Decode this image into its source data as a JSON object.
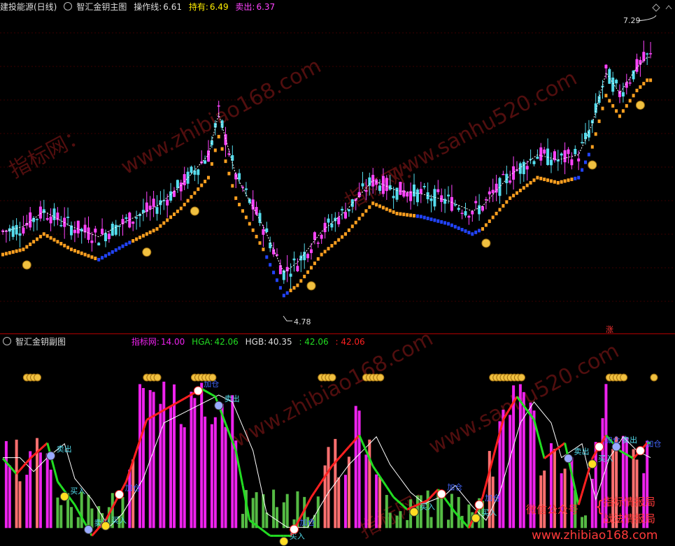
{
  "main_header": {
    "stock": "建投能源(日线)",
    "indicator": "智汇金钥主图",
    "op_label": "操作线:",
    "op_value": "6.61",
    "hold_label": "持有:",
    "hold_value": "6.49",
    "sell_label": "卖出:",
    "sell_value": "6.37"
  },
  "sub_header": {
    "indicator": "智汇金钥副图",
    "zbw_label": "指标网:",
    "zbw_value": "14.00",
    "hga_label": "HGA:",
    "hga_value": "42.06",
    "hgb_label": "HGB:",
    "hgb_value": "40.35",
    "v4": ": 42.06",
    "v5": ": 42.06"
  },
  "labels": {
    "high": "7.29",
    "low": "4.78",
    "zhang": "涨",
    "sell": "卖出",
    "buy": "买入",
    "add": "加仓",
    "wechat": "微信公众号",
    "brand1": "指标情报局",
    "brand2": "战法情报局",
    "site": "www.zhibiao168.com",
    "wm1": "www.zhibiao168.com",
    "wm2": "www.sanhu520.com",
    "wm3": "指标网：",
    "wm4": "指标网："
  },
  "colors": {
    "up": "#ff44ff",
    "down": "#55ddee",
    "hold": "#ffa020",
    "sell_line": "#2244ff",
    "green": "#22dd22",
    "red": "#ff2020",
    "magenta": "#ee22ee",
    "salmon": "#ff7070",
    "gbar": "#55bb44"
  },
  "chart_data": [
    {
      "type": "candlestick",
      "y_range": [
        4.5,
        7.5
      ],
      "high": 7.29,
      "low": 4.78,
      "anchors": [
        [
          0,
          5.35
        ],
        [
          6,
          5.4
        ],
        [
          12,
          5.55
        ],
        [
          20,
          5.4
        ],
        [
          28,
          5.3
        ],
        [
          36,
          5.45
        ],
        [
          45,
          5.6
        ],
        [
          52,
          5.8
        ],
        [
          60,
          6.1
        ],
        [
          63,
          6.5
        ],
        [
          68,
          5.9
        ],
        [
          76,
          5.4
        ],
        [
          82,
          4.95
        ],
        [
          86,
          5.05
        ],
        [
          93,
          5.35
        ],
        [
          100,
          5.55
        ],
        [
          108,
          5.85
        ],
        [
          115,
          5.75
        ],
        [
          122,
          5.72
        ],
        [
          130,
          5.65
        ],
        [
          137,
          5.55
        ],
        [
          140,
          5.6
        ],
        [
          148,
          5.9
        ],
        [
          156,
          6.1
        ],
        [
          162,
          6.05
        ],
        [
          168,
          6.1
        ],
        [
          172,
          6.4
        ],
        [
          176,
          6.9
        ],
        [
          180,
          6.7
        ],
        [
          185,
          6.95
        ],
        [
          188,
          7.05
        ]
      ],
      "money_bag_bars": [
        7,
        42,
        56,
        90,
        141,
        172,
        186
      ]
    },
    {
      "type": "bar+line",
      "y_range": [
        -8,
        105
      ],
      "hga_anchors": [
        [
          0,
          45
        ],
        [
          4,
          35
        ],
        [
          8,
          45
        ],
        [
          13,
          55
        ],
        [
          16,
          30
        ],
        [
          21,
          15
        ],
        [
          26,
          -5
        ],
        [
          30,
          5
        ],
        [
          36,
          30
        ],
        [
          42,
          70
        ],
        [
          50,
          80
        ],
        [
          58,
          90
        ],
        [
          62,
          85
        ],
        [
          68,
          50
        ],
        [
          72,
          5
        ],
        [
          78,
          -5
        ],
        [
          84,
          -5
        ],
        [
          90,
          20
        ],
        [
          96,
          40
        ],
        [
          104,
          60
        ],
        [
          108,
          40
        ],
        [
          114,
          20
        ],
        [
          118,
          12
        ],
        [
          124,
          18
        ],
        [
          127,
          25
        ],
        [
          132,
          10
        ],
        [
          136,
          0
        ],
        [
          140,
          20
        ],
        [
          146,
          70
        ],
        [
          150,
          85
        ],
        [
          155,
          70
        ],
        [
          158,
          45
        ],
        [
          164,
          55
        ],
        [
          168,
          15
        ],
        [
          172,
          45
        ],
        [
          176,
          60
        ],
        [
          180,
          50
        ],
        [
          184,
          45
        ],
        [
          188,
          55
        ]
      ],
      "sells": [
        [
          14,
          "卖出"
        ],
        [
          25,
          "卖出"
        ],
        [
          63,
          "卖出"
        ],
        [
          165,
          "卖出"
        ],
        [
          179,
          "卖出"
        ]
      ],
      "buys": [
        [
          18,
          "买入"
        ],
        [
          30,
          "买入"
        ],
        [
          82,
          "买入"
        ],
        [
          120,
          "买入"
        ],
        [
          138,
          "买入"
        ],
        [
          172,
          "买入"
        ]
      ],
      "adds": [
        [
          34,
          "加仓"
        ],
        [
          57,
          "加仓"
        ],
        [
          85,
          "加仓"
        ],
        [
          128,
          "加仓"
        ],
        [
          139,
          "加仓"
        ],
        [
          174,
          "加仓"
        ],
        [
          186,
          "加仓"
        ]
      ]
    }
  ]
}
